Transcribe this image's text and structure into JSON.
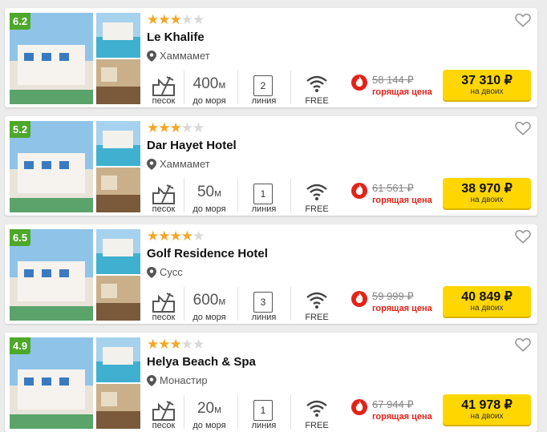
{
  "colors": {
    "rating_bg": "#4ea82a",
    "star_on": "#f5a623",
    "price_button": "#ffd600",
    "hot": "#e2231a"
  },
  "labels": {
    "sand": "песок",
    "distance": "до моря",
    "line": "линия",
    "wifi": "FREE",
    "hot_price": "горящая цена",
    "for_two": "на двоих",
    "distance_unit": "м"
  },
  "hotels": [
    {
      "rating": "6.2",
      "stars": 3,
      "name": "Le Khalife",
      "location": "Хаммамет",
      "distance": "400",
      "line": "2",
      "old_price": "58 144 ₽",
      "price": "37 310 ₽"
    },
    {
      "rating": "5.2",
      "stars": 3,
      "name": "Dar Hayet Hotel",
      "location": "Хаммамет",
      "distance": "50",
      "line": "1",
      "old_price": "61 561 ₽",
      "price": "38 970 ₽"
    },
    {
      "rating": "6.5",
      "stars": 4,
      "name": "Golf Residence Hotel",
      "location": "Сусс",
      "distance": "600",
      "line": "3",
      "old_price": "59 999 ₽",
      "price": "40 849 ₽"
    },
    {
      "rating": "4.9",
      "stars": 3,
      "name": "Helya Beach & Spa",
      "location": "Монастир",
      "distance": "20",
      "line": "1",
      "old_price": "67 944 ₽",
      "price": "41 978 ₽"
    }
  ]
}
